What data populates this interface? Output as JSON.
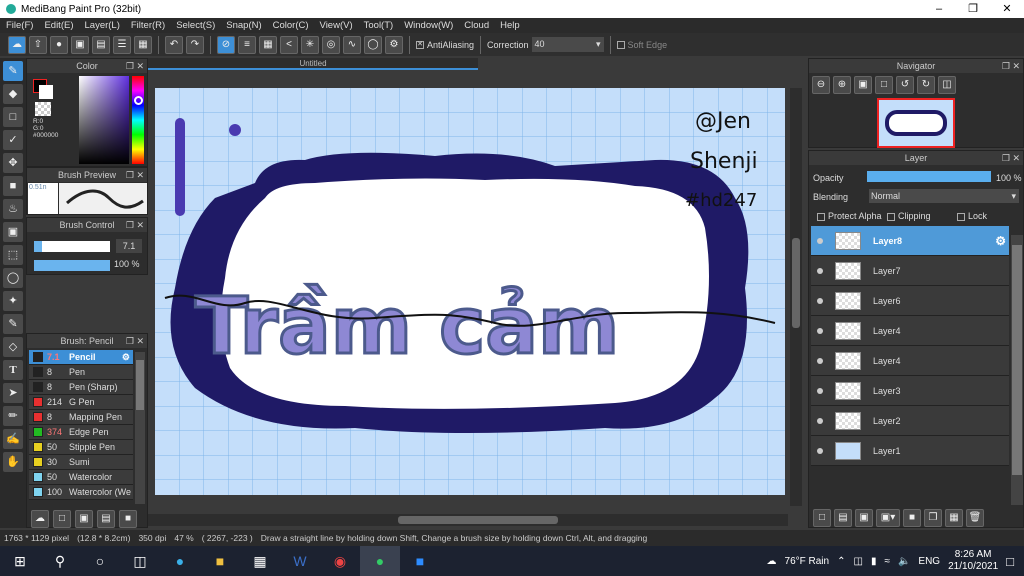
{
  "app": {
    "title": "MediBang Paint Pro (32bit)"
  },
  "menu": [
    "File(F)",
    "Edit(E)",
    "Layer(L)",
    "Filter(R)",
    "Select(S)",
    "Snap(N)",
    "Color(C)",
    "View(V)",
    "Tool(T)",
    "Window(W)",
    "Cloud",
    "Help"
  ],
  "toolbar": {
    "antialiasing": "AntiAliasing",
    "correction_label": "Correction",
    "correction_value": "40",
    "soft_edge": "Soft Edge"
  },
  "color_panel": {
    "title": "Color",
    "r": "R:0",
    "g": "G:0",
    "b": "B:0",
    "hex": "#000000",
    "fg": "#000000",
    "bg": "#ffffff"
  },
  "brush_preview": {
    "title": "Brush Preview",
    "size": "0.51n"
  },
  "brush_control": {
    "title": "Brush Control",
    "size": "7.1",
    "opacity": "100 %",
    "size_fraction": 0.1,
    "opacity_fraction": 1.0
  },
  "brush_list": {
    "title": "Brush: Pencil",
    "items": [
      {
        "size": "7.1",
        "name": "Pencil",
        "color": "#222222",
        "selected": true
      },
      {
        "size": "8",
        "name": "Pen",
        "color": "#222222"
      },
      {
        "size": "8",
        "name": "Pen (Sharp)",
        "color": "#222222"
      },
      {
        "size": "214",
        "name": "G Pen",
        "color": "#e83030"
      },
      {
        "size": "8",
        "name": "Mapping Pen",
        "color": "#e83030"
      },
      {
        "size": "374",
        "name": "Edge Pen",
        "color": "#22bb22"
      },
      {
        "size": "50",
        "name": "Stipple Pen",
        "color": "#e8d020"
      },
      {
        "size": "30",
        "name": "Sumi",
        "color": "#e8d020"
      },
      {
        "size": "50",
        "name": "Watercolor",
        "color": "#7fd4f0"
      },
      {
        "size": "100",
        "name": "Watercolor (We",
        "color": "#7fd4f0"
      }
    ]
  },
  "canvas": {
    "tab": "Untitled",
    "signature": [
      "@Jen",
      "Shenji",
      "#hd247"
    ],
    "artwork_text": "Trầm cảm"
  },
  "navigator": {
    "title": "Navigator"
  },
  "layer_panel": {
    "title": "Layer",
    "opacity_label": "Opacity",
    "opacity_value": "100 %",
    "blending_label": "Blending",
    "blending_value": "Normal",
    "protect_alpha": "Protect Alpha",
    "clipping": "Clipping",
    "lock": "Lock",
    "layers": [
      {
        "name": "Layer8",
        "selected": true
      },
      {
        "name": "Layer7"
      },
      {
        "name": "Layer6"
      },
      {
        "name": "Layer4"
      },
      {
        "name": "Layer4"
      },
      {
        "name": "Layer3"
      },
      {
        "name": "Layer2"
      },
      {
        "name": "Layer1"
      }
    ]
  },
  "status": {
    "pixels": "1763 * 1129 pixel",
    "cm": "(12.8 * 8.2cm)",
    "dpi": "350 dpi",
    "zoom": "47 %",
    "coords": "( 2267, -223 )",
    "hint": "Draw a straight line by holding down Shift, Change a brush size by holding down Ctrl, Alt, and dragging"
  },
  "taskbar": {
    "weather": "76°F  Rain",
    "lang": "ENG",
    "time": "8:26 AM",
    "date": "21/10/2021"
  }
}
